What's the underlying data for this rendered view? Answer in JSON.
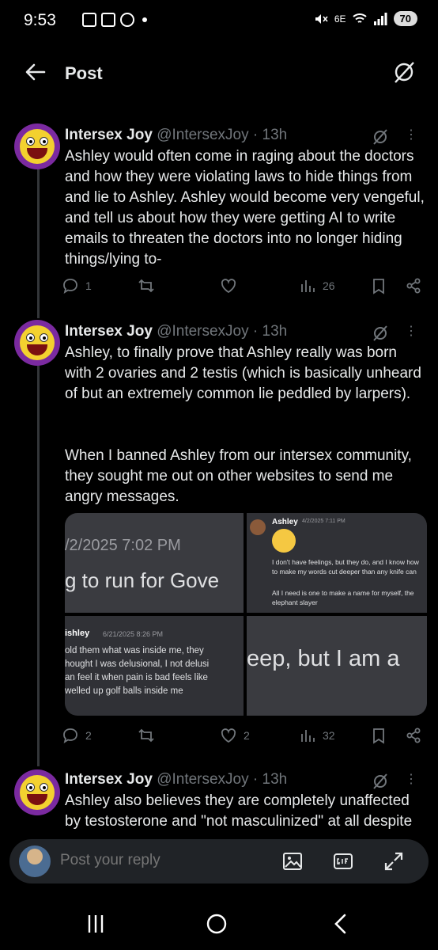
{
  "status_bar": {
    "time": "9:53",
    "network": "6E",
    "battery": "70"
  },
  "header": {
    "title": "Post"
  },
  "posts": [
    {
      "name": "Intersex Joy",
      "handle": "@IntersexJoy",
      "time": "· 13h",
      "text": "Ashley would often come in raging about the doctors and how they were violating laws to hide things from and lie to Ashley. Ashley would become very vengeful, and tell us about how they were getting AI to write emails to threaten the doctors into no longer hiding things/lying to-",
      "replies": "1",
      "reposts": "",
      "likes": "",
      "views": "26"
    },
    {
      "name": "Intersex Joy",
      "handle": "@IntersexJoy",
      "time": "· 13h",
      "text_p1": "Ashley, to finally prove that Ashley really was born with 2 ovaries and 2 testis (which is basically unheard of but an extremely common lie peddled by larpers).",
      "text_p2": "When I banned Ashley from our intersex community, they sought me out on other websites to send me angry messages.",
      "replies": "2",
      "reposts": "",
      "likes": "2",
      "views": "32"
    },
    {
      "name": "Intersex Joy",
      "handle": "@IntersexJoy",
      "time": "· 13h",
      "text": "Ashley also believes they are completely unaffected by testosterone and \"not masculinized\" at all despite"
    }
  ],
  "media": {
    "img1_date": "/2/2025 7:02 PM",
    "img1_text": "g to run for Gove",
    "img2_name": "Ashley",
    "img2_time": "4/2/2025 7:11 PM",
    "img2_line1": "I don't have feelings, but they do, and I know how to make my words cut deeper than any knife can",
    "img2_line2": "All I need is one to make a name for myself, the elephant slayer",
    "img3_name": "ishley",
    "img3_time": "6/21/2025 8:26 PM",
    "img3_body": "old them what was inside me, they\nhought I was delusional, I not delusi\nan feel it when pain is bad feels like\nwelled up golf balls inside me",
    "img4_text": "eep, but I am a"
  },
  "reply": {
    "placeholder": "Post your reply"
  },
  "icons": {
    "back": "arrow-left-icon",
    "grok": "grok-icon",
    "reply": "speech-bubble-icon",
    "repost": "repost-icon",
    "like": "heart-icon",
    "views": "bar-chart-icon",
    "bookmark": "bookmark-icon",
    "share": "share-icon"
  }
}
